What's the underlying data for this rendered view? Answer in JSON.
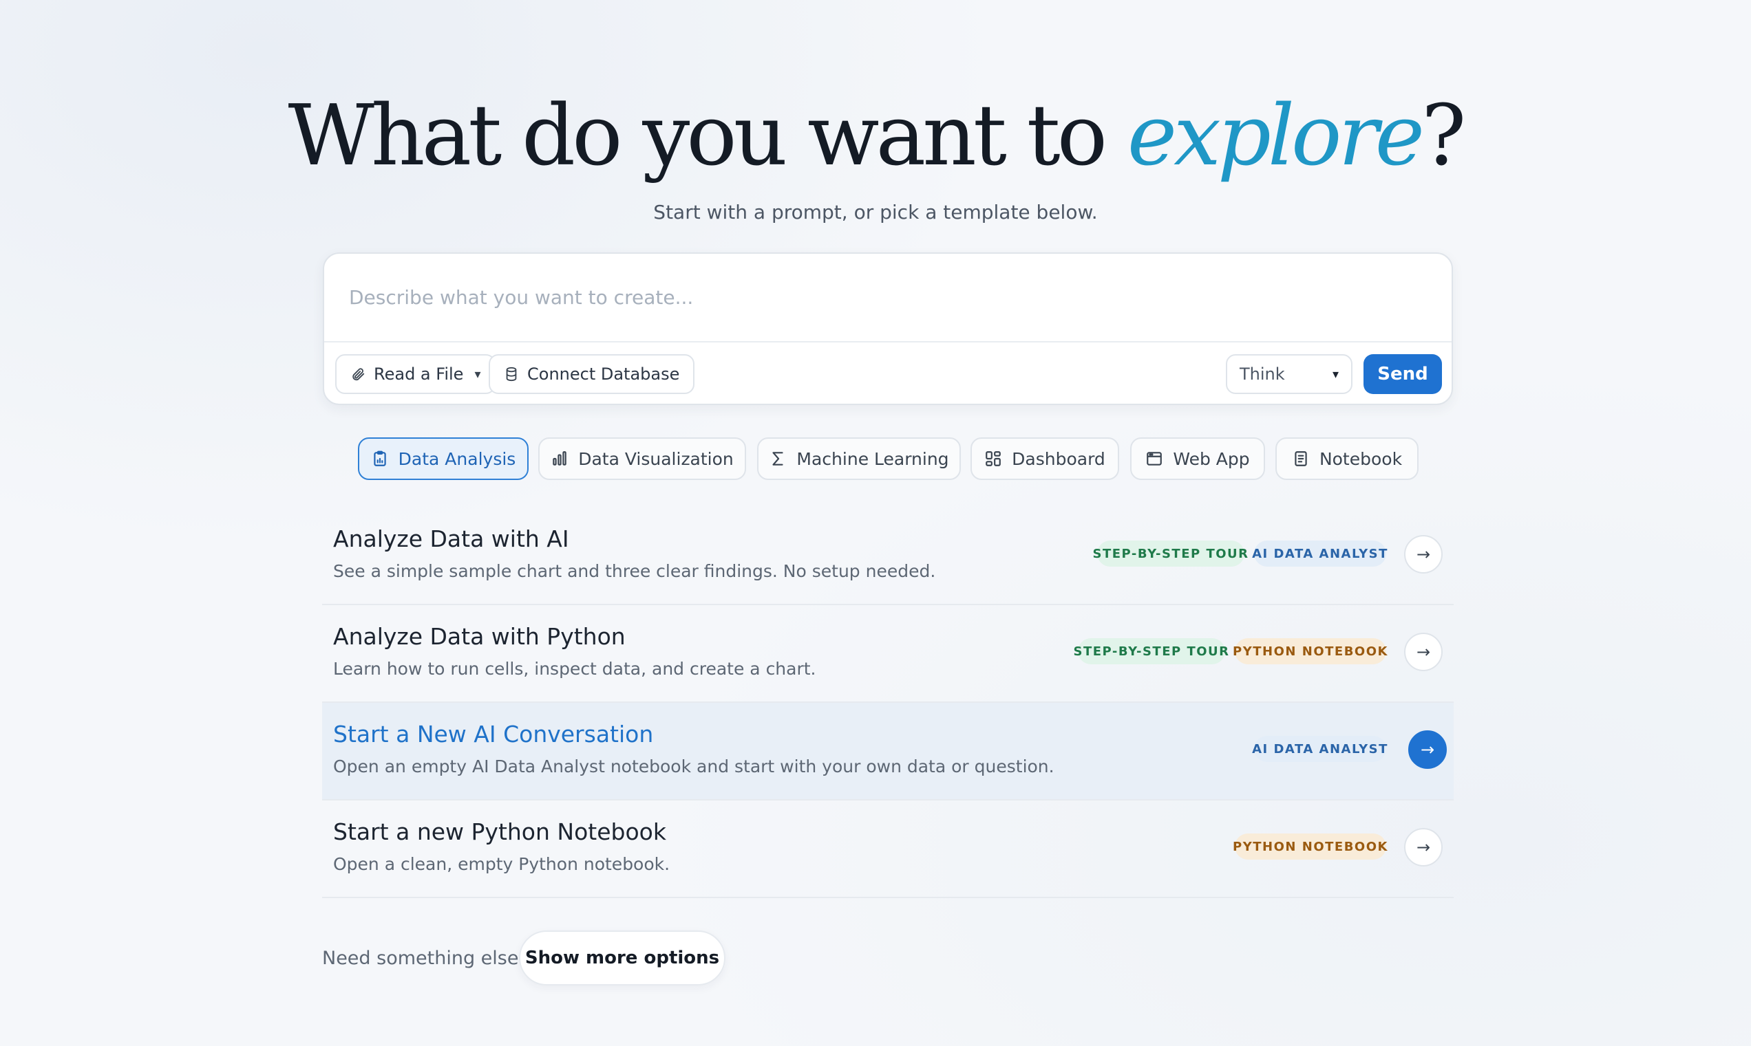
{
  "hero": {
    "title_main": "What do you want to ",
    "title_accent": "explore",
    "title_end": "?",
    "subtitle": "Start with a prompt, or pick a template below."
  },
  "prompt": {
    "placeholder": "Describe what you want to create...",
    "read_file_label": "Read a File",
    "connect_db_label": "Connect Database",
    "mode_value": "Think",
    "send_label": "Send"
  },
  "tabs": [
    {
      "label": "Data Analysis",
      "icon": "clipboard-chart-icon",
      "active": true
    },
    {
      "label": "Data Visualization",
      "icon": "bar-chart-icon",
      "active": false
    },
    {
      "label": "Machine Learning",
      "icon": "sigma-icon",
      "active": false
    },
    {
      "label": "Dashboard",
      "icon": "grid-icon",
      "active": false
    },
    {
      "label": "Web App",
      "icon": "browser-icon",
      "active": false
    },
    {
      "label": "Notebook",
      "icon": "document-icon",
      "active": false
    }
  ],
  "templates": [
    {
      "title": "Analyze Data with AI",
      "description": "See a simple sample chart and three clear findings. No setup needed.",
      "badges": [
        "STEP-BY-STEP TOUR",
        "AI DATA ANALYST"
      ]
    },
    {
      "title": "Analyze Data with Python",
      "description": "Learn how to run cells, inspect data, and create a chart.",
      "badges": [
        "STEP-BY-STEP TOUR",
        "PYTHON NOTEBOOK"
      ]
    },
    {
      "title": "Start a New AI Conversation",
      "description": "Open an empty AI Data Analyst notebook and start with your own data or question.",
      "badges": [
        "AI DATA ANALYST"
      ]
    },
    {
      "title": "Start a new Python Notebook",
      "description": "Open a clean, empty Python notebook.",
      "badges": [
        "PYTHON NOTEBOOK"
      ]
    }
  ],
  "footer": {
    "question": "Need something else?",
    "more_label": "Show more options"
  },
  "colors": {
    "accent": "#1f97c6",
    "primary": "#1f72d1"
  }
}
